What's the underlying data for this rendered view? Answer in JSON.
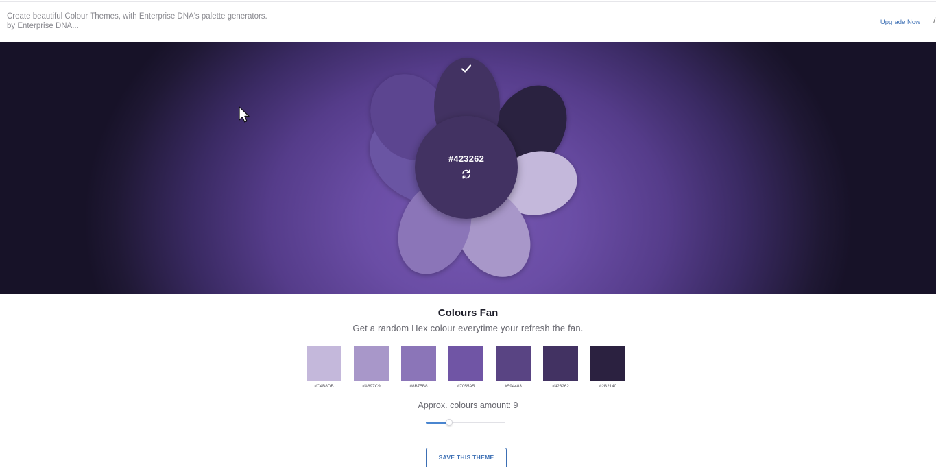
{
  "header": {
    "line1": "Create beautiful Colour Themes, with Enterprise DNA's palette generators.",
    "line2": "by Enterprise DNA...",
    "upgrade_label": "Upgrade Now"
  },
  "fan": {
    "selected_hex": "#423262",
    "petal_colors": [
      "#423262",
      "#2B2140",
      "#C4B8DB",
      "#A897C9",
      "#8B75B8",
      "#7055A5",
      "#594483"
    ]
  },
  "section": {
    "title": "Colours Fan",
    "subtitle": "Get a random Hex colour everytime your refresh the fan."
  },
  "swatches": [
    {
      "hex": "#C4B8DB",
      "label": "#C4B8DB"
    },
    {
      "hex": "#A897C9",
      "label": "#A897C9"
    },
    {
      "hex": "#8B75B8",
      "label": "#8B75B8"
    },
    {
      "hex": "#7055A5",
      "label": "#7055A5"
    },
    {
      "hex": "#594483",
      "label": "#594483"
    },
    {
      "hex": "#423262",
      "label": "#423262"
    },
    {
      "hex": "#2B2140",
      "label": "#2B2140"
    }
  ],
  "amount": {
    "label": "Approx. colours amount: 9",
    "value": 9,
    "fill_fraction": 0.29
  },
  "save_label": "SAVE THIS THEME",
  "colors": {
    "accent": "#3C6FB4",
    "slider_fill": "#4A86D0"
  },
  "icons": [
    "check-icon",
    "refresh-icon",
    "cursor-arrow-icon"
  ]
}
